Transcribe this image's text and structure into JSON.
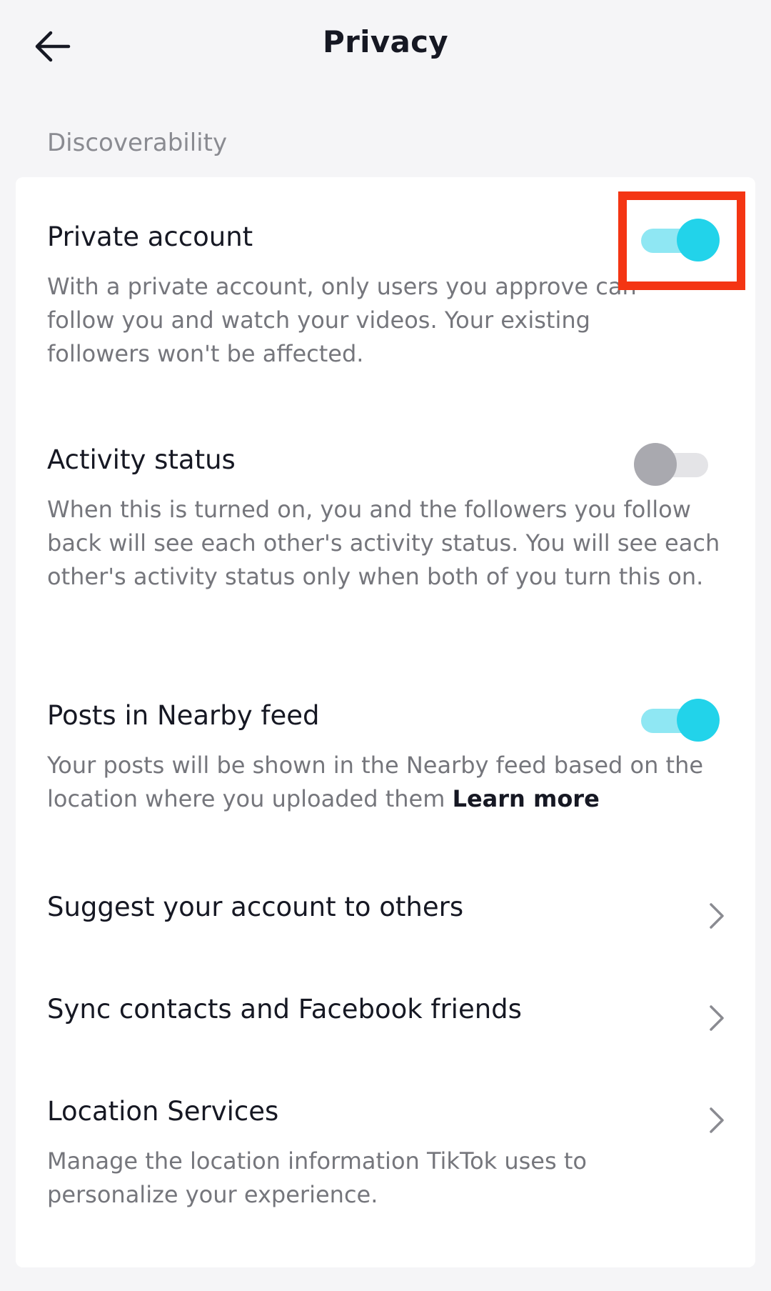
{
  "header": {
    "title": "Privacy",
    "back_icon": "arrow-left-icon"
  },
  "section": {
    "label": "Discoverability"
  },
  "settings": {
    "private_account": {
      "title": "Private account",
      "description": "With a private account, only users you approve can follow you and watch your videos. Your existing followers won't be affected.",
      "enabled": true
    },
    "activity_status": {
      "title": "Activity status",
      "description": "When this is turned on, you and the followers you follow back will see each other's activity status. You will see each other's activity status only when both of you turn this on.",
      "enabled": false
    },
    "nearby_feed": {
      "title": "Posts in Nearby feed",
      "description": "Your posts will be shown in the Nearby feed based on the location where you uploaded them",
      "link": "Learn more",
      "enabled": true
    },
    "suggest_account": {
      "title": "Suggest your account to others"
    },
    "sync_contacts": {
      "title": "Sync contacts and Facebook friends"
    },
    "location_services": {
      "title": "Location Services",
      "description": "Manage the location information TikTok uses to personalize your experience."
    }
  },
  "colors": {
    "toggle_on": "#22d3ea",
    "toggle_on_track": "#8fe7f3",
    "toggle_off": "#a9a9af",
    "highlight": "#f43513"
  }
}
